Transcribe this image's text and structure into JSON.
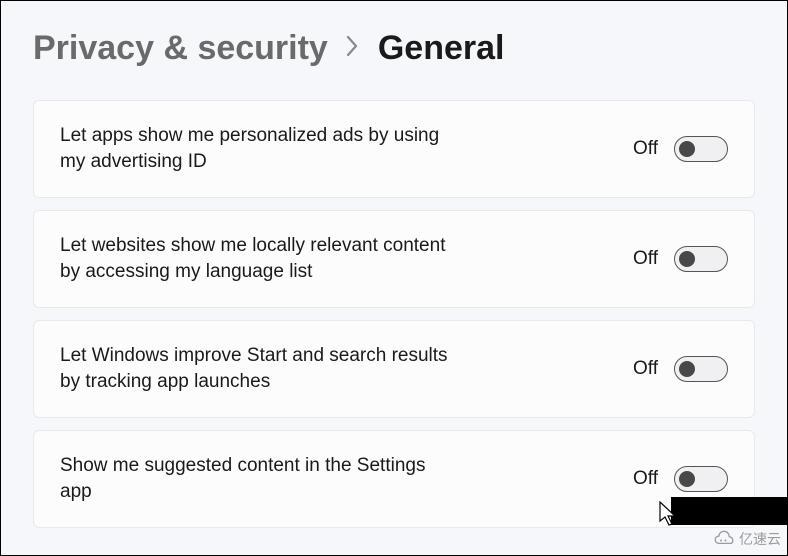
{
  "breadcrumb": {
    "parent": "Privacy & security",
    "current": "General"
  },
  "settings": [
    {
      "label": "Let apps show me personalized ads by using my advertising ID",
      "status": "Off",
      "on": false
    },
    {
      "label": "Let websites show me locally relevant content by accessing my language list",
      "status": "Off",
      "on": false
    },
    {
      "label": "Let Windows improve Start and search results by tracking app launches",
      "status": "Off",
      "on": false
    },
    {
      "label": "Show me suggested content in the Settings app",
      "status": "Off",
      "on": false
    }
  ],
  "watermark": "亿速云"
}
